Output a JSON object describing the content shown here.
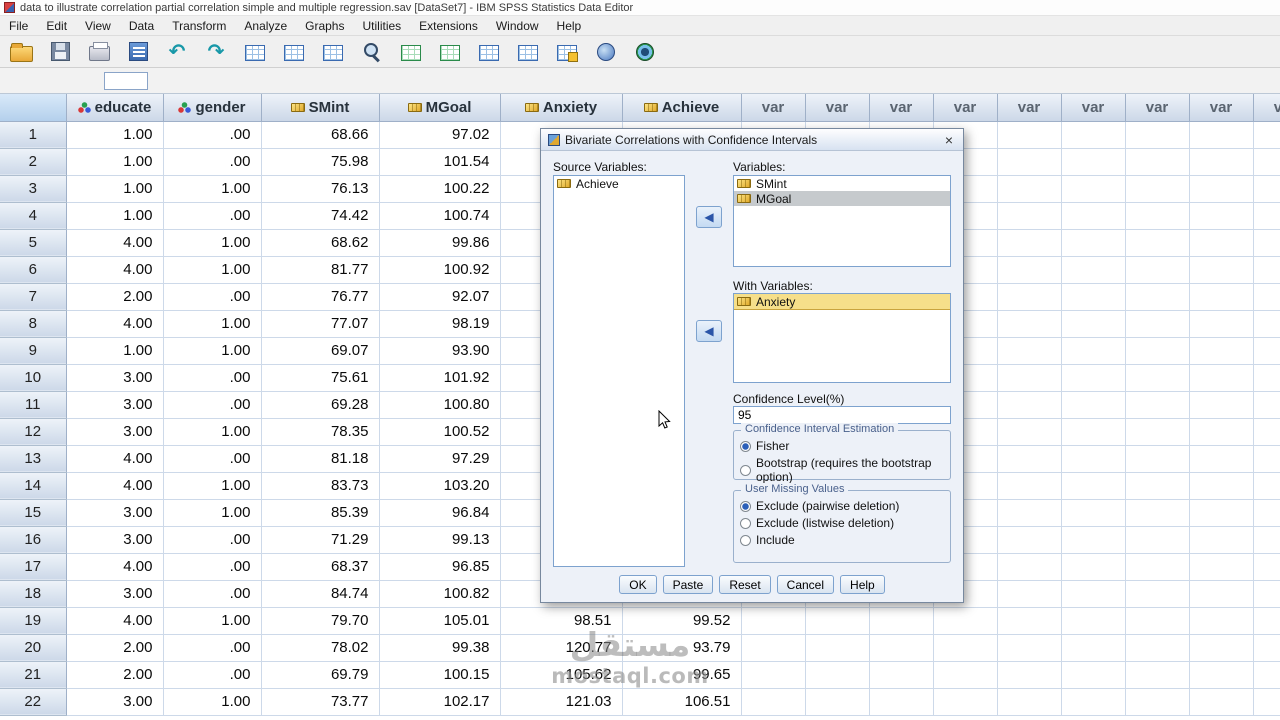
{
  "window": {
    "title": "data to illustrate correlation partial correlation simple and multiple regression.sav [DataSet7] - IBM SPSS Statistics Data Editor",
    "close_glyph": "×"
  },
  "menu_bar": {
    "items": [
      "File",
      "Edit",
      "View",
      "Data",
      "Transform",
      "Analyze",
      "Graphs",
      "Utilities",
      "Extensions",
      "Window",
      "Help"
    ]
  },
  "toolbar": {
    "icons": [
      "open-data-icon",
      "save-icon",
      "print-icon",
      "recall-dialogs-icon",
      "undo-icon",
      "redo-icon",
      "goto-case-icon",
      "goto-variable-icon",
      "variables-icon",
      "find-icon",
      "insert-cases-icon",
      "insert-variable-icon",
      "split-file-icon",
      "weight-cases-icon",
      "value-labels-icon",
      "use-variable-sets-icon",
      "custom-toolbar-icon"
    ]
  },
  "grid": {
    "columns": [
      {
        "label": "educate",
        "type": "nominal"
      },
      {
        "label": "gender",
        "type": "nominal"
      },
      {
        "label": "SMint",
        "type": "scale"
      },
      {
        "label": "MGoal",
        "type": "scale"
      },
      {
        "label": "Anxiety",
        "type": "scale"
      },
      {
        "label": "Achieve",
        "type": "scale"
      },
      {
        "label": "var"
      },
      {
        "label": "var"
      },
      {
        "label": "var"
      },
      {
        "label": "var"
      },
      {
        "label": "var"
      },
      {
        "label": "var"
      },
      {
        "label": "var"
      },
      {
        "label": "var"
      },
      {
        "label": "var"
      }
    ],
    "rows": [
      [
        "1",
        "1.00",
        ".00",
        "68.66",
        "97.02",
        "",
        ""
      ],
      [
        "2",
        "1.00",
        ".00",
        "75.98",
        "101.54",
        "",
        ""
      ],
      [
        "3",
        "1.00",
        "1.00",
        "76.13",
        "100.22",
        "",
        ""
      ],
      [
        "4",
        "1.00",
        ".00",
        "74.42",
        "100.74",
        "",
        ""
      ],
      [
        "5",
        "4.00",
        "1.00",
        "68.62",
        "99.86",
        "",
        ""
      ],
      [
        "6",
        "4.00",
        "1.00",
        "81.77",
        "100.92",
        "",
        ""
      ],
      [
        "7",
        "2.00",
        ".00",
        "76.77",
        "92.07",
        "",
        ""
      ],
      [
        "8",
        "4.00",
        "1.00",
        "77.07",
        "98.19",
        "",
        ""
      ],
      [
        "9",
        "1.00",
        "1.00",
        "69.07",
        "93.90",
        "",
        ""
      ],
      [
        "10",
        "3.00",
        ".00",
        "75.61",
        "101.92",
        "",
        ""
      ],
      [
        "11",
        "3.00",
        ".00",
        "69.28",
        "100.80",
        "",
        ""
      ],
      [
        "12",
        "3.00",
        "1.00",
        "78.35",
        "100.52",
        "",
        ""
      ],
      [
        "13",
        "4.00",
        ".00",
        "81.18",
        "97.29",
        "",
        ""
      ],
      [
        "14",
        "4.00",
        "1.00",
        "83.73",
        "103.20",
        "",
        ""
      ],
      [
        "15",
        "3.00",
        "1.00",
        "85.39",
        "96.84",
        "",
        ""
      ],
      [
        "16",
        "3.00",
        ".00",
        "71.29",
        "99.13",
        "",
        ""
      ],
      [
        "17",
        "4.00",
        ".00",
        "68.37",
        "96.85",
        "",
        ""
      ],
      [
        "18",
        "3.00",
        ".00",
        "84.74",
        "100.82",
        "",
        ""
      ],
      [
        "19",
        "4.00",
        "1.00",
        "79.70",
        "105.01",
        "98.51",
        "99.52"
      ],
      [
        "20",
        "2.00",
        ".00",
        "78.02",
        "99.38",
        "120.77",
        "93.79"
      ],
      [
        "21",
        "2.00",
        ".00",
        "69.79",
        "100.15",
        "105.62",
        "99.65"
      ],
      [
        "22",
        "3.00",
        "1.00",
        "73.77",
        "102.17",
        "121.03",
        "106.51"
      ]
    ]
  },
  "dialog": {
    "title": "Bivariate Correlations with Confidence Intervals",
    "move_arrow": "◀",
    "source_list": {
      "label": "Source Variables:",
      "items": [
        {
          "name": "Achieve"
        }
      ]
    },
    "variables_list": {
      "label": "Variables:",
      "items": [
        {
          "name": "SMint"
        },
        {
          "name": "MGoal",
          "state": "gray"
        }
      ]
    },
    "with_variables_list": {
      "label": "With Variables:",
      "items": [
        {
          "name": "Anxiety",
          "state": "yellow"
        }
      ]
    },
    "confidence": {
      "label": "Confidence Level(%)",
      "value": "95"
    },
    "cie_group": {
      "label": "Confidence Interval Estimation",
      "options": [
        {
          "label": "Fisher",
          "checked": true
        },
        {
          "label": "Bootstrap (requires the bootstrap option)"
        }
      ]
    },
    "umv_group": {
      "label": "User Missing Values",
      "options": [
        {
          "label": "Exclude (pairwise deletion)",
          "checked": true
        },
        {
          "label": "Exclude (listwise deletion)"
        },
        {
          "label": "Include"
        }
      ]
    },
    "buttons": [
      "OK",
      "Paste",
      "Reset",
      "Cancel",
      "Help"
    ]
  },
  "watermark": {
    "logo": "مستقل",
    "text": "mostaql.com"
  }
}
